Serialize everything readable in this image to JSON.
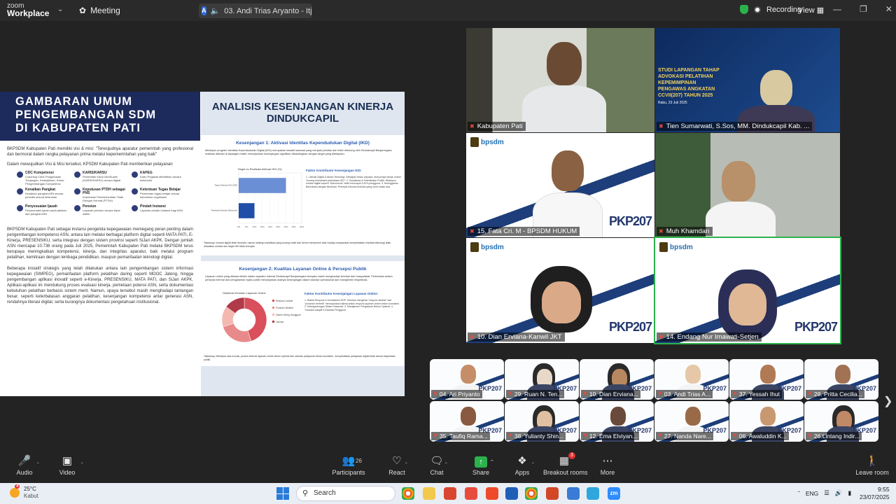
{
  "app": {
    "logo_line1": "zoom",
    "logo_line2": "Workplace",
    "meeting_label": "Meeting",
    "share_tab_label": "03. Andi Trias Aryanto - Itjen'",
    "share_tab_letter": "A",
    "recording_label": "Recording",
    "view_label": "View"
  },
  "shared_doc": {
    "left": {
      "title_lines": [
        "GAMBARAN UMUM",
        "PENGEMBANGAN SDM",
        "DI KABUPATEN PATI"
      ],
      "intro": "BKPSDM Kabupaten Pati memiliki visi & misi: \"Terwujudnya aparatur pemerintah yang profesional dan bermoral dalam rangka pelayanan prima melalui kepemerintahan yang baik\"",
      "lead": "Dalam mewujudkan Visi & Misi tersebut, KPSDM Kabupaten Pati memberikan pelayanan",
      "items": [
        {
          "title": "CDC Kompetensi",
          "text": "Coaching Clinic Pengelolaan Tunjangan, Kedisiplinan, Karier, Pengembangan Kompetensi"
        },
        {
          "title": "KARIS/KARSU",
          "text": "Penerbitan Kartu Istri/Suami (KARIS/KARSU) secara digital"
        },
        {
          "title": "KAPEG",
          "text": "Kartu Pegawai diterbitkan secara elektronik"
        },
        {
          "title": "Kenaikan Pangkat",
          "text": "Kenaikan pangkat ASN secara periodik sesuai ketentuan"
        },
        {
          "title": "Keputusan PTDH sebagai PNS",
          "text": "Keputusan Pemberhentian Tidak Dengan Hormat (PTDH)"
        },
        {
          "title": "Ketentuan Tugas Belajar",
          "text": "Pemberian tugas belajar sesuai kebutuhan organisasi"
        },
        {
          "title": "Penyesuaian Ijazah",
          "text": "Penyesuaian ijazah pada jabatan dan pangkat ASN"
        },
        {
          "title": "Pensiun",
          "text": "Layanan pensiun secara tepat waktu"
        },
        {
          "title": "Pindah Instansi",
          "text": "Layanan pindah instansi bagi ASN"
        }
      ],
      "para2": "BKPSDM Kabupaten Pati sebagai instansi pengelola kepegawaian memegang peran penting dalam pengembangan kompetensi ASN, antara lain melalui berbagai platform digital seperti MATA PATI, E-Kinerja, PRESENSIKU, serta integrasi dengan sistem provinsi seperti SiJari AKPK. Dengan jumlah ASN mencapai 10.736 orang pada Juli 2025, Pemerintah Kabupaten Pati melalui BKPSDM terus berupaya meningkatkan kompetensi, kinerja, dan integritas aparatur, baik melalui program pelatihan, kemitraan dengan lembaga pendidikan, maupun pemanfaatan teknologi digital.",
      "para3": "Beberapa inisiatif strategis yang telah dilakukan antara lain pengembangan sistem informasi kepegawaian (SIMPEG), pemanfaatan platform pelatihan daring seperti MOOC Jateng, hingga pengembangan aplikasi inovatif seperti e-Kinerja, PRESENSIKU, MATA PATI, dan SiJari AKPK. Aplikasi-aplikasi ini mendukung proses evaluasi kinerja, pemetaan potensi ASN, serta dokumentasi kebutuhan pelatihan berbasis sistem merit. Namun, upaya tersebut masih menghadapi tantangan besar, seperti keterbatasan anggaran pelatihan, kesenjangan kompetensi antar generasi ASN, rendahnya literasi digital, serta kurangnya dokumentasi pengetahuan institusional."
    },
    "right": {
      "title_line1": "ANALISIS KESENJANGAN KINERJA",
      "title_line2": "DINDUKCAPIL",
      "gap1": {
        "heading": "Kesenjangan 1: Aktivasi Identitas Kependudukan Digital (IKD)",
        "intro": "Meskipun program Identitas Kependudukan Digital (IKD) merupakan inisiatif nasional yang menjadi prioritas dan telah didorong oleh Dindukcapil Banjarnegara, realisasi aktivasi di lapangan masih menunjukkan kesenjangan signifikan dibandingkan dengan target yang ditetapkan.",
        "factor_heading": "Faktor Kontributor Kesenjangan IKD:",
        "factors": "1. Literasi Digital & Akses Teknologi: Sebagian besar populasi, khususnya lansia, masih \"kurang memahami perbedaan IKD\". 2. Sosialisasi & Keterlibatan Publik: Meskipun inovasi digital seperti \"Dukommun\" telah mencapai 4,81% pengguna. 3. Keengganan Bertransisi dengan Birokrasi: Persepsi historis birokrasi yang rumit masih ada.",
        "note": "Takeaway: Inovasi digital telah tersedia, namun strategi sosialisasi yang kurang masif dan belum menyentuh akar budaya masyarakat menyebabkan manfaat teknologi tidak dirasakan merata dan target IKD tidak tercapai."
      },
      "gap2": {
        "heading": "Kesenjangan 2: Kualitas Layanan Online & Persepsi Publik",
        "intro": "Layanan online yang dibawa efisien dalam aparatur internal Dindukcapil Banjarnegara ternyata masih menghadapi keluhan dari masyarakat. Perbedaan antara persepsi internal dan pengalaman nyata publik menunjukkan adanya kesenjangan dalam standar operasional dan manajemen ekspektasi.",
        "factor_heading": "Faktor Kontributor Kesenjangan Layanan Online:",
        "factors": "1. Waktu Respons & Konsistensi SOP: Keluhan mengenai \"respons lambat\" dan \"prosedur berbelit\" menunjukkan bahwa waktu respons layanan online belum konsisten. 2. Ketergantungan Sistem Nasional. 3. Manajemen Pengaduan Belum Optimal. 4. Tuntutan Adaptif & Edukasi Pengguna.",
        "note": "Takeaway: Meskipun ada inovasi, proses internal layanan online belum optimal dan standar pelayanan belum konsisten, menyebabkan pelayanan digital tidak sesuai ekspektasi publik."
      }
    }
  },
  "chart_data": [
    {
      "type": "bar",
      "title": "Target vs Realisasi Aktivasi IKD (%)",
      "orientation": "horizontal",
      "categories": [
        "Target Aktivasi IKD 2025",
        "Realisasi Aktivasi (Estimasi)"
      ],
      "values": [
        30,
        10
      ],
      "xlim": [
        0,
        40
      ],
      "xticks": [
        "0%",
        "5%",
        "10%",
        "15%",
        "20%",
        "25%",
        "30%",
        "35%",
        "40%"
      ],
      "colors": [
        "#6b8fd4",
        "#1f4fa8"
      ]
    },
    {
      "type": "pie",
      "title": "Distribusi Keluhan Layanan Online",
      "donut": true,
      "slices": [
        {
          "label": "Respons Lambat",
          "value": 45,
          "color": "#d94f5c"
        },
        {
          "label": "Prosedur Berbelit",
          "value": 25,
          "color": "#e88a8a"
        },
        {
          "label": "Sistem Sering Gangguan",
          "value": 15,
          "color": "#f3b8b0"
        },
        {
          "label": "Lainnya",
          "value": 15,
          "color": "#b03a48"
        }
      ]
    }
  ],
  "video_large": [
    {
      "name": "Kabupaten Pati",
      "muted": true
    },
    {
      "name": "Tien Sumarwati, S.Sos, MM. Dindukcapil Kab. ...",
      "muted": true,
      "banner_title": "STUDI LAPANGAN TAHAP ADVOKASI PELATIHAN KEPEMIMPINAN PENGAWAS ANGKATAN CCVII(207) TAHUN 2025",
      "banner_date": "Rabu, 23 Juli 2025"
    },
    {
      "name": "15. Fata Cri. M - BPSDM HUKUM",
      "muted": true,
      "brand": "bpsdm",
      "pkp": "PKP207"
    },
    {
      "name": "Muh Khamdan",
      "muted": true
    },
    {
      "name": "10. Dian Erviana-Kanwil JKT",
      "muted": true,
      "brand": "bpsdm",
      "pkp": "PKP207"
    },
    {
      "name": "14. Endang Nur Imawati-Setjen",
      "muted": true,
      "brand": "bpsdm",
      "pkp": "PKP207"
    }
  ],
  "video_small": [
    {
      "name": "04. Ari Priyanto"
    },
    {
      "name": "29. Ruan N. Ten..."
    },
    {
      "name": "10. Dian Erviana..."
    },
    {
      "name": "03. Andi Trias A..."
    },
    {
      "name": "37. Yessah Ihut"
    },
    {
      "name": "28. Pritta Cecilia..."
    },
    {
      "name": "35. Taufiq Rama..."
    },
    {
      "name": "38. Yulianty Shin..."
    },
    {
      "name": "12. Ema Elviyan..."
    },
    {
      "name": "27. Nanda Nare..."
    },
    {
      "name": "06. Awaluddin K..."
    },
    {
      "name": "26.Lintang Indir..."
    }
  ],
  "toolbar": {
    "audio": "Audio",
    "video": "Video",
    "participants": "Participants",
    "participants_count": "26",
    "react": "React",
    "chat": "Chat",
    "share": "Share",
    "apps": "Apps",
    "breakout": "Breakout rooms",
    "breakout_badge": "3",
    "more": "More",
    "leave": "Leave room"
  },
  "taskbar": {
    "weather_temp": "25°C",
    "weather_desc": "Kabut",
    "weather_badge": "4",
    "search": "Search",
    "lang": "ENG",
    "time": "9:55",
    "date": "23/07/2025"
  },
  "colors": {
    "accent_green": "#2bb24c",
    "mute_red": "#e74c3c",
    "doc_navy": "#1d2a5c"
  }
}
